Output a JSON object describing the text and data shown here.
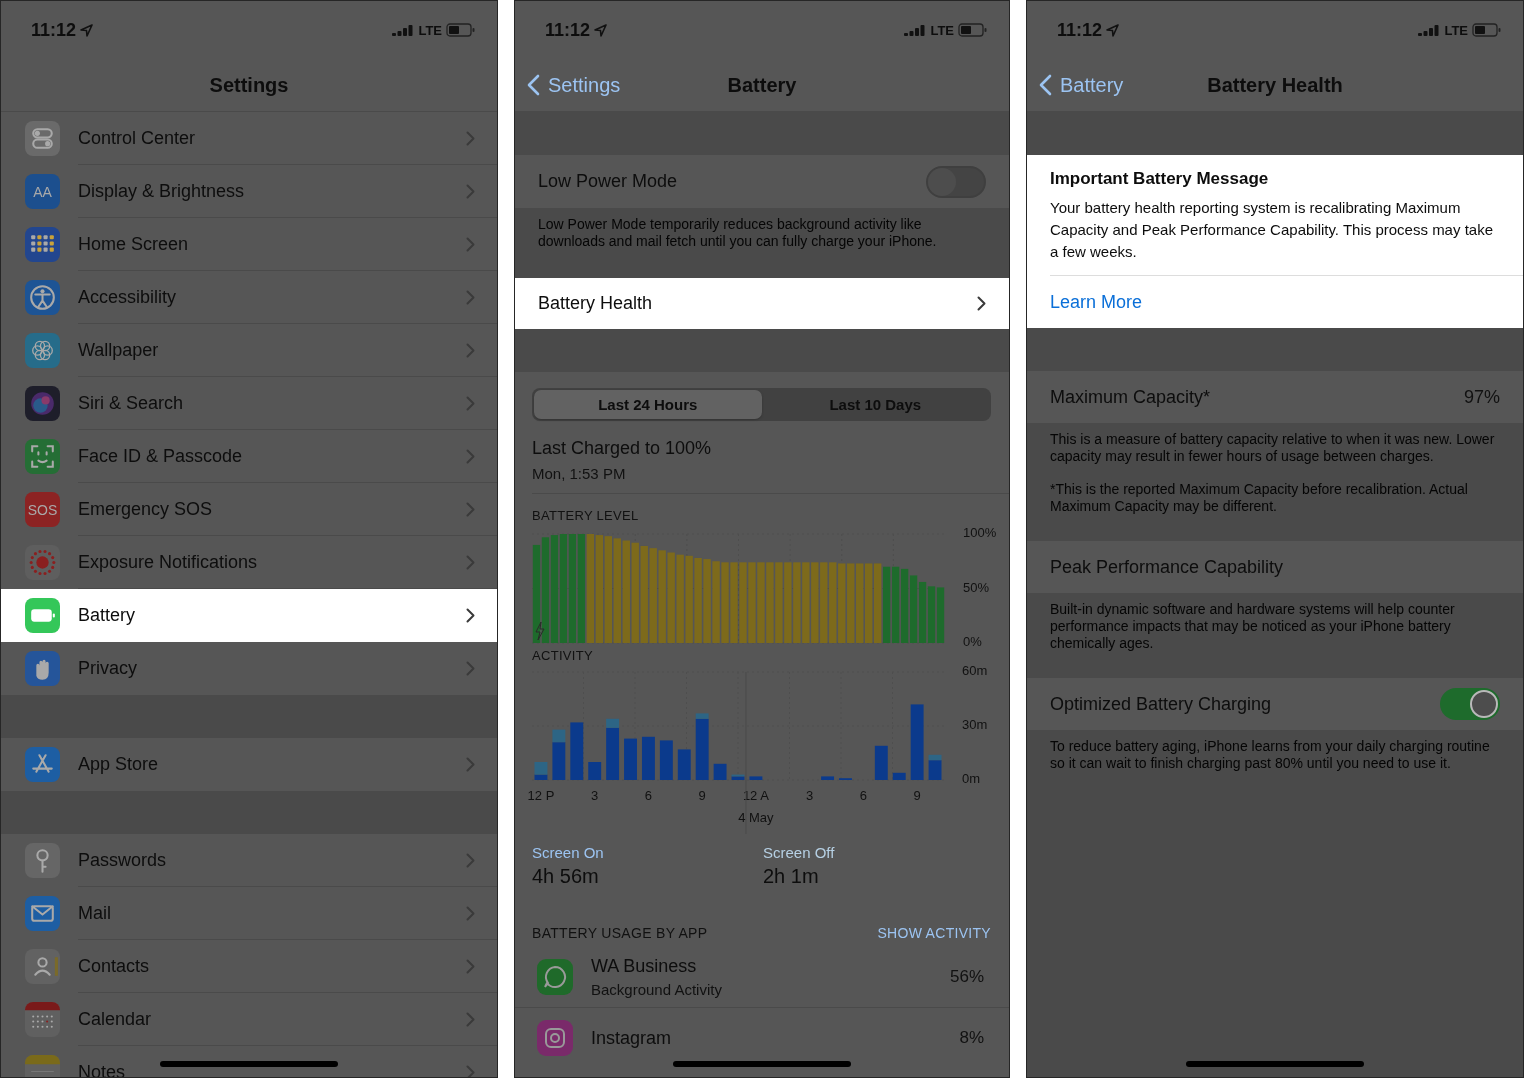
{
  "screens": [
    {
      "kind": "settings",
      "status_bar": {
        "time": "11:12",
        "network": "LTE"
      },
      "title": "Settings",
      "groups": [
        {
          "items": [
            {
              "label": "Control Center",
              "color": "#6a6a6a",
              "selected": false
            },
            {
              "label": "Display & Brightness",
              "color": "#1c4f8e",
              "icon_text": "AA",
              "selected": false
            },
            {
              "label": "Home Screen",
              "color": "#22468f",
              "selected": false
            },
            {
              "label": "Accessibility",
              "color": "#1d5495",
              "selected": false
            },
            {
              "label": "Wallpaper",
              "color": "#266c8a",
              "selected": false
            },
            {
              "label": "Siri & Search",
              "color": "#1e1e2a",
              "selected": false
            },
            {
              "label": "Face ID & Passcode",
              "color": "#256e35",
              "selected": false
            },
            {
              "label": "Emergency SOS",
              "color": "#8c2323",
              "icon_text": "SOS",
              "selected": false
            },
            {
              "label": "Exposure Notifications",
              "color": "#5e5e5e",
              "selected": false
            },
            {
              "label": "Battery",
              "color": "#34c759",
              "selected": true
            },
            {
              "label": "Privacy",
              "color": "#25559a",
              "selected": false
            }
          ]
        },
        {
          "items": [
            {
              "label": "App Store",
              "color": "#1d5ea3",
              "selected": false
            }
          ]
        },
        {
          "items": [
            {
              "label": "Passwords",
              "color": "#666666",
              "selected": false
            },
            {
              "label": "Mail",
              "color": "#1d5ea3",
              "selected": false
            },
            {
              "label": "Contacts",
              "color": "#626262",
              "selected": false
            },
            {
              "label": "Calendar",
              "color": "#606060",
              "selected": false
            },
            {
              "label": "Notes",
              "color": "#606060",
              "selected": false
            }
          ]
        }
      ]
    },
    {
      "kind": "battery",
      "status_bar": {
        "time": "11:12",
        "network": "LTE"
      },
      "back": "Settings",
      "title": "Battery",
      "low_power_mode": {
        "label": "Low Power Mode",
        "on": false,
        "footer": "Low Power Mode temporarily reduces background activity like downloads and mail fetch until you can fully charge your iPhone."
      },
      "battery_health": {
        "label": "Battery Health",
        "selected": true
      },
      "segments": [
        {
          "label": "Last 24 Hours",
          "selected": true
        },
        {
          "label": "Last 10 Days",
          "selected": false
        }
      ],
      "last_charged": {
        "title": "Last Charged to 100%",
        "subtitle": "Mon, 1:53 PM"
      },
      "battery_level": {
        "chart_data": {
          "type": "bar",
          "title": "BATTERY LEVEL",
          "grid": true,
          "categories": [
            null,
            null,
            null,
            null,
            null,
            null,
            null,
            null,
            null,
            null,
            null,
            null,
            null,
            null,
            null,
            null,
            null,
            null,
            null,
            null,
            null,
            null,
            null,
            null,
            null,
            null,
            null,
            null,
            null,
            null,
            null,
            null,
            null,
            null,
            null,
            null,
            null,
            null,
            null,
            null,
            null,
            null,
            null,
            null,
            null,
            null
          ],
          "ylim": [
            0,
            100
          ],
          "yticks": [
            {
              "value": 100,
              "label": "100%"
            },
            {
              "value": 50,
              "label": "50%"
            },
            {
              "value": 0,
              "label": "0%"
            }
          ],
          "series": [
            {
              "color": "#1e6b2c",
              "values": [
                90,
                97,
                99,
                100,
                100,
                100,
                0,
                0,
                0,
                0,
                0,
                0,
                0,
                0,
                0,
                0,
                0,
                0,
                0,
                0,
                0,
                0,
                0,
                0,
                0,
                0,
                0,
                0,
                0,
                0,
                0,
                0,
                0,
                0,
                0,
                0,
                0,
                0,
                0,
                70,
                70,
                68,
                62,
                56,
                52,
                51
              ]
            },
            {
              "color": "#7d6a1b",
              "values": [
                0,
                0,
                0,
                0,
                0,
                0,
                100,
                99,
                98,
                96,
                94,
                92,
                89,
                87,
                85,
                83,
                81,
                80,
                78,
                77,
                75,
                74,
                74,
                74,
                74,
                74,
                74,
                74,
                74,
                74,
                74,
                74,
                74,
                74,
                73,
                73,
                73,
                73,
                73,
                0,
                0,
                0,
                0,
                0,
                0,
                0
              ]
            }
          ],
          "stacked": true
        }
      },
      "activity": {
        "chart_data": {
          "type": "bar",
          "title": "ACTIVITY",
          "grid": true,
          "stacked": true,
          "categories": [
            "12 P",
            null,
            null,
            "3",
            null,
            null,
            "6",
            null,
            null,
            "9",
            null,
            null,
            "12 A",
            null,
            null,
            "3",
            null,
            null,
            "6",
            null,
            null,
            "9",
            null
          ],
          "ylim": [
            0,
            60
          ],
          "yticks": [
            {
              "value": 60,
              "label": "60m"
            },
            {
              "value": 30,
              "label": "30m"
            },
            {
              "value": 0,
              "label": "0m"
            }
          ],
          "annotations": [
            "4 May"
          ],
          "series": [
            {
              "name": "Screen On",
              "color": "#0b3a8c",
              "values": [
                3,
                21,
                32,
                10,
                29,
                23,
                24,
                22,
                17,
                34,
                9,
                2,
                2,
                0,
                0,
                0,
                2,
                1,
                0,
                19,
                4,
                42,
                11
              ]
            },
            {
              "name": "Screen Off",
              "color": "#2d6585",
              "values": [
                7,
                7,
                0,
                0,
                5,
                0,
                0,
                0,
                0,
                3,
                0,
                1,
                0,
                0,
                0,
                0,
                0,
                0,
                0,
                0,
                0,
                0,
                3
              ]
            }
          ]
        }
      },
      "screen_time": [
        {
          "value": "4h 56m"
        },
        {
          "value": "2h 1m"
        }
      ],
      "usage": {
        "header": "BATTERY USAGE BY APP",
        "action": "SHOW ACTIVITY",
        "apps": [
          {
            "name": "WA Business",
            "detail": "Background Activity",
            "percent": "56%",
            "color": "#1f6a2a"
          },
          {
            "name": "Instagram",
            "percent": "8%",
            "color": "#7a2a6a"
          }
        ]
      }
    },
    {
      "kind": "battery_health",
      "status_bar": {
        "time": "11:12",
        "network": "LTE"
      },
      "back": "Battery",
      "title": "Battery Health",
      "message": {
        "title": "Important Battery Message",
        "text": "Your battery health reporting system is recalibrating Maximum Capacity and Peak Performance Capability. This process may take a few weeks.",
        "link": "Learn More"
      },
      "sections": [
        {
          "label": "Maximum Capacity*",
          "value": "97%",
          "footers": [
            "This is a measure of battery capacity relative to when it was new. Lower capacity may result in fewer hours of usage between charges.",
            "*This is the reported Maximum Capacity before recalibration. Actual Maximum Capacity may be different."
          ]
        },
        {
          "label": "Peak Performance Capability",
          "footers": [
            "Built-in dynamic software and hardware systems will help counter performance impacts that may be noticed as your iPhone battery chemically ages."
          ]
        },
        {
          "label": "Optimized Battery Charging",
          "on": true,
          "footers": [
            "To reduce battery aging, iPhone learns from your daily charging routine so it can wait to finish charging past 80% until you need to use it."
          ]
        }
      ]
    }
  ]
}
